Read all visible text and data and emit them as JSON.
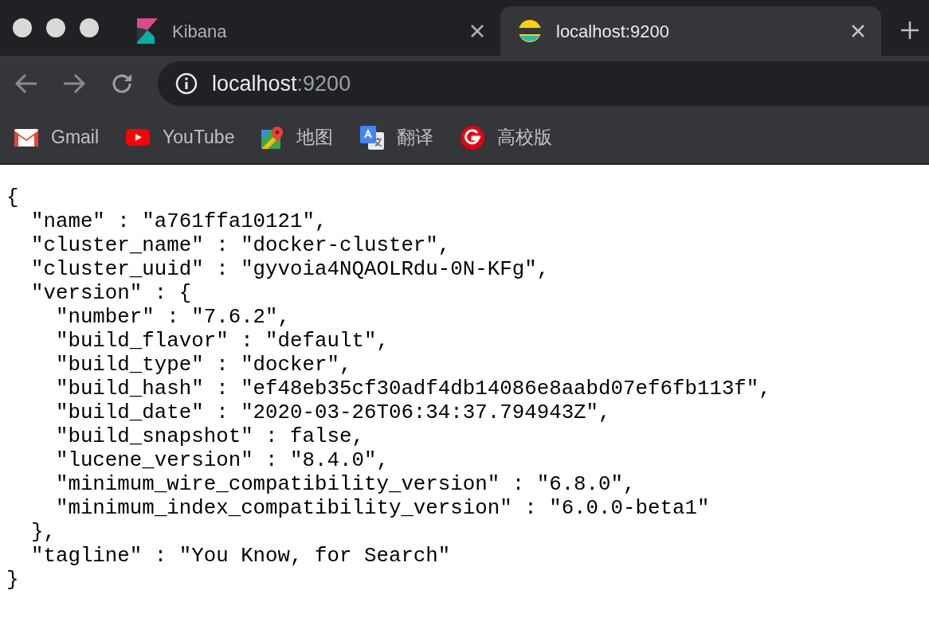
{
  "tabs": [
    {
      "title": "Kibana",
      "selected": false,
      "kind": "kibana"
    },
    {
      "title": "localhost:9200",
      "selected": true,
      "kind": "elastic"
    }
  ],
  "address": {
    "host": "localhost",
    "port": ":9200"
  },
  "bookmarks": [
    {
      "label": "Gmail",
      "kind": "gmail"
    },
    {
      "label": "YouTube",
      "kind": "youtube"
    },
    {
      "label": "地图",
      "kind": "maps"
    },
    {
      "label": "翻译",
      "kind": "translate"
    },
    {
      "label": "高校版",
      "kind": "g"
    }
  ],
  "document": {
    "lines": [
      "{",
      "  \"name\" : \"a761ffa10121\",",
      "  \"cluster_name\" : \"docker-cluster\",",
      "  \"cluster_uuid\" : \"gyvoia4NQAOLRdu-0N-KFg\",",
      "  \"version\" : {",
      "    \"number\" : \"7.6.2\",",
      "    \"build_flavor\" : \"default\",",
      "    \"build_type\" : \"docker\",",
      "    \"build_hash\" : \"ef48eb35cf30adf4db14086e8aabd07ef6fb113f\",",
      "    \"build_date\" : \"2020-03-26T06:34:37.794943Z\",",
      "    \"build_snapshot\" : false,",
      "    \"lucene_version\" : \"8.4.0\",",
      "    \"minimum_wire_compatibility_version\" : \"6.8.0\",",
      "    \"minimum_index_compatibility_version\" : \"6.0.0-beta1\"",
      "  },",
      "  \"tagline\" : \"You Know, for Search\"",
      "}"
    ]
  }
}
